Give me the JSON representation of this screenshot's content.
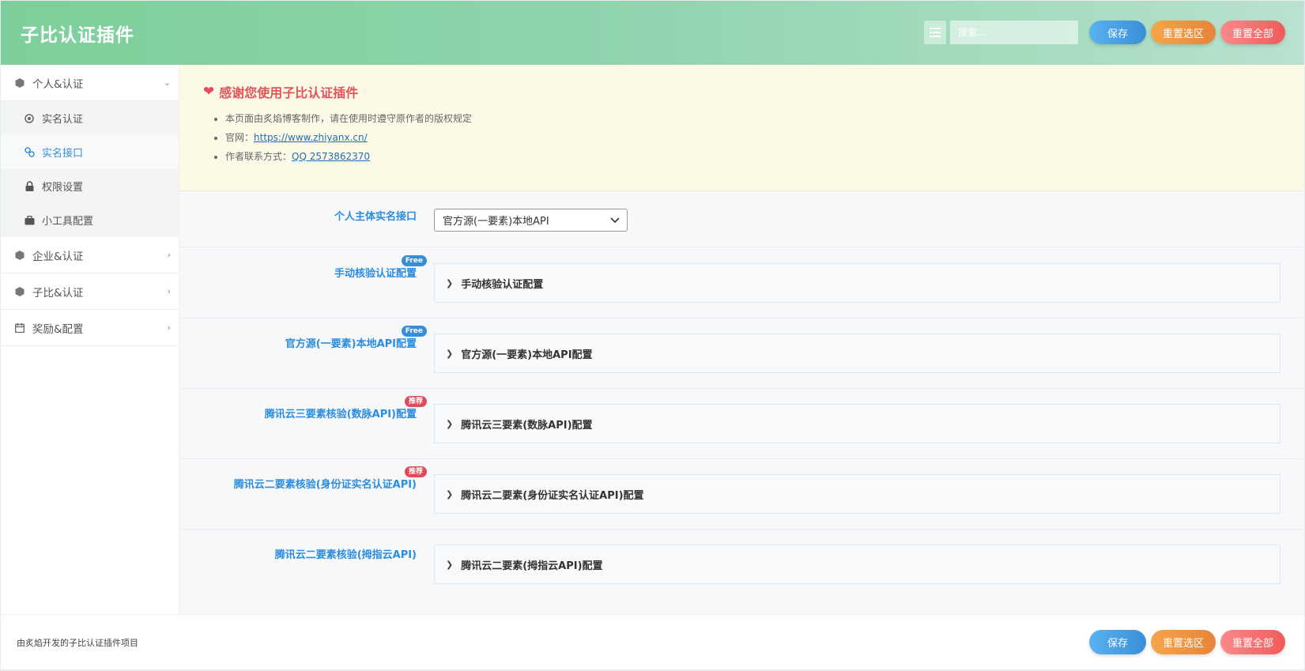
{
  "header": {
    "title": "子比认证插件",
    "search_placeholder": "搜索...",
    "save_label": "保存",
    "reset_section_label": "重置选区",
    "reset_all_label": "重置全部"
  },
  "sidebar": {
    "groups": [
      {
        "label": "个人&认证",
        "expanded": true,
        "icon": "cube-icon",
        "items": [
          {
            "label": "实名认证",
            "icon": "target-icon",
            "active": false
          },
          {
            "label": "实名接口",
            "icon": "link-icon",
            "active": true
          },
          {
            "label": "权限设置",
            "icon": "lock-icon",
            "active": false
          },
          {
            "label": "小工具配置",
            "icon": "briefcase-icon",
            "active": false
          }
        ]
      },
      {
        "label": "企业&认证",
        "expanded": false,
        "icon": "cube-icon"
      },
      {
        "label": "子比&认证",
        "expanded": false,
        "icon": "cube-icon"
      },
      {
        "label": "奖励&配置",
        "expanded": false,
        "icon": "calendar-icon"
      }
    ]
  },
  "notice": {
    "title": "感谢您使用子比认证插件",
    "line1": "本页面由炙焰博客制作，请在使用时遵守原作者的版权规定",
    "site_prefix": "官网：",
    "site_link": "https://www.zhiyanx.cn/",
    "contact_prefix": "作者联系方式：",
    "contact_link": "QQ 2573862370"
  },
  "fields": {
    "personal_api": {
      "label": "个人主体实名接口",
      "value": "官方源(一要素)本地API"
    },
    "sections": [
      {
        "label": "手动核验认证配置",
        "badge": "Free",
        "panel": "手动核验认证配置"
      },
      {
        "label": "官方源(一要素)本地API配置",
        "badge": "Free",
        "panel": "官方源(一要素)本地API配置"
      },
      {
        "label": "腾讯云三要素核验(数脉API)配置",
        "badge": "推荐",
        "panel": "腾讯云三要素(数脉API)配置"
      },
      {
        "label": "腾讯云二要素核验(身份证实名认证API)",
        "badge": "推荐",
        "panel": "腾讯云二要素(身份证实名认证API)配置"
      },
      {
        "label": "腾讯云二要素核验(拇指云API)",
        "badge": "",
        "panel": "腾讯云二要素(拇指云API)配置"
      }
    ]
  },
  "footer": {
    "text": "由炙焰开发的子比认证插件项目",
    "save_label": "保存",
    "reset_section_label": "重置选区",
    "reset_all_label": "重置全部"
  },
  "colors": {
    "accent_blue": "#3a8ed8",
    "label_blue": "#2b8ce0",
    "orange": "#e7843a",
    "red": "#f05b5b",
    "notice_bg": "#fdf9e7"
  }
}
